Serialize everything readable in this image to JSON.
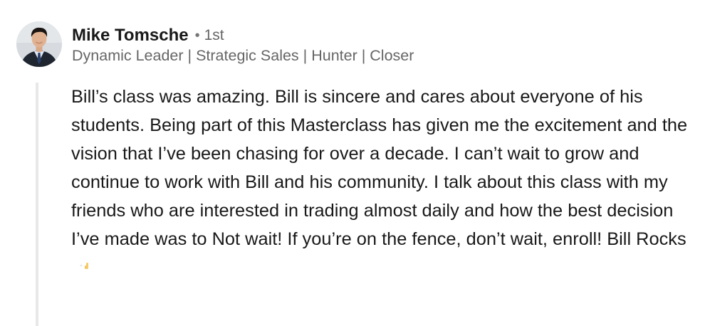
{
  "comment": {
    "author": {
      "name": "Mike Tomsche",
      "bullet": "•",
      "degree": "1st",
      "headline": "Dynamic Leader | Strategic Sales | Hunter | Closer"
    },
    "text": "Bill’s class was amazing. Bill is sincere and cares about everyone of his students. Being part of this Masterclass has given me the excitement and the vision that I’ve been chasing for over a decade. I can’t wait to grow and continue to work with Bill and his community. I talk about this class with my friends who are interested in trading almost daily and how the best decision I’ve made was to Not wait! If you’re on the fence, don’t wait, enroll! Bill Rocks",
    "emoji_icon": "rock-on-hand-emoji-icon"
  }
}
